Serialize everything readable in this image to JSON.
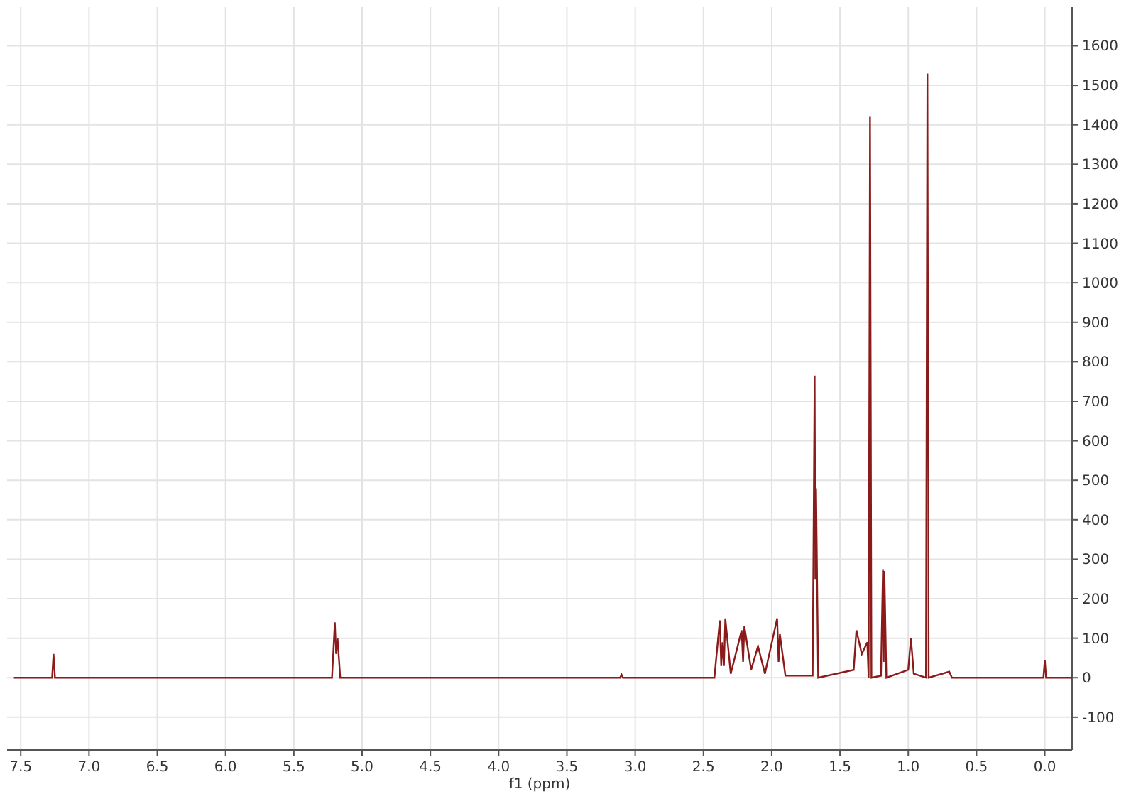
{
  "spectrum": {
    "chart_data": {
      "type": "line",
      "xlabel": "f1 (ppm)",
      "grid": true,
      "xlim": [
        7.6,
        -0.2
      ],
      "ylim": [
        -183,
        1698
      ],
      "xticks": [
        {
          "value": 7.5,
          "label": "7.5"
        },
        {
          "value": 7,
          "label": "7.0"
        },
        {
          "value": 6.5,
          "label": "6.5"
        },
        {
          "value": 6,
          "label": "6.0"
        },
        {
          "value": 5.5,
          "label": "5.5"
        },
        {
          "value": 5,
          "label": "5.0"
        },
        {
          "value": 4.5,
          "label": "4.5"
        },
        {
          "value": 4,
          "label": "4.0"
        },
        {
          "value": 3.5,
          "label": "3.5"
        },
        {
          "value": 3,
          "label": "3.0"
        },
        {
          "value": 2.5,
          "label": "2.5"
        },
        {
          "value": 2,
          "label": "2.0"
        },
        {
          "value": 1.5,
          "label": "1.5"
        },
        {
          "value": 1,
          "label": "1.0"
        },
        {
          "value": 0.5,
          "label": "0.5"
        },
        {
          "value": 0,
          "label": "0.0"
        }
      ],
      "yticks": [
        -100,
        0,
        100,
        200,
        300,
        400,
        500,
        600,
        700,
        800,
        900,
        1000,
        1100,
        1200,
        1300,
        1400,
        1500,
        1600
      ],
      "x": [
        7.55,
        7.27,
        7.26,
        7.25,
        5.22,
        5.2,
        5.19,
        5.18,
        5.16,
        3.11,
        3.1,
        3.09,
        2.42,
        2.38,
        2.37,
        2.36,
        2.35,
        2.34,
        2.3,
        2.22,
        2.21,
        2.2,
        2.15,
        2.1,
        2.05,
        1.96,
        1.95,
        1.94,
        1.9,
        1.7,
        1.685,
        1.68,
        1.675,
        1.66,
        1.4,
        1.38,
        1.36,
        1.34,
        1.3,
        1.29,
        1.28,
        1.27,
        1.2,
        1.185,
        1.18,
        1.175,
        1.16,
        1.0,
        0.98,
        0.96,
        0.87,
        0.86,
        0.85,
        0.7,
        0.68,
        0.01,
        0.0,
        -0.01,
        -0.2
      ],
      "series": [
        {
          "color": "#8b1a1a",
          "values": [
            0,
            0,
            60,
            0,
            0,
            140,
            60,
            100,
            0,
            0,
            8,
            0,
            0,
            145,
            30,
            90,
            30,
            150,
            10,
            120,
            40,
            130,
            20,
            80,
            10,
            150,
            40,
            110,
            5,
            5,
            765,
            250,
            480,
            0,
            20,
            120,
            90,
            60,
            90,
            0,
            1420,
            0,
            5,
            275,
            40,
            270,
            0,
            20,
            100,
            10,
            0,
            1530,
            0,
            15,
            0,
            0,
            45,
            0,
            0
          ]
        }
      ]
    }
  }
}
